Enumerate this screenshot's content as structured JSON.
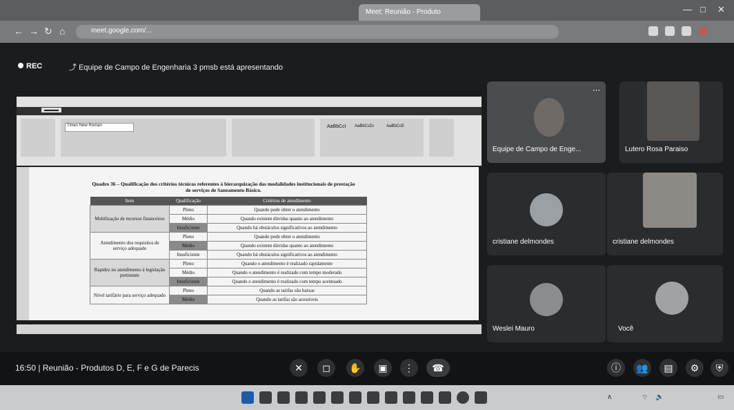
{
  "browser": {
    "tabs": [
      {
        "label": "Meet: Reunião - Produto"
      }
    ],
    "url": "meet.google.com/..."
  },
  "meet": {
    "rec_label": "REC",
    "presenting_banner": "Equipe de Campo de Engenharia 3 pmsb está apresentando",
    "participants": [
      {
        "name": "Equipe de Campo de Enge..."
      },
      {
        "name": "Lutero Rosa Paraiso"
      },
      {
        "name": "cristiane delmondes"
      },
      {
        "name": "cristiane delmondes"
      },
      {
        "name": "Weslei Mauro"
      },
      {
        "name": "Você"
      }
    ],
    "time": "16:50",
    "meeting_title": "Reunião - Produtos D, E, F e G de Parecis"
  },
  "document": {
    "font_box": "Times New Roman",
    "style_samples": [
      "AaBbCcI",
      "AaBbCcDı",
      "AaBbCcE"
    ],
    "caption": "Quadro 36 – Qualificação dos critérios técnicos referentes à bierarquização das modalidades institucionais de prestação de serviços de Saneamento Básico.",
    "table": {
      "headers": [
        "Item",
        "Qualificação",
        "Critérios de atendimento"
      ],
      "rows": [
        {
          "item": "Mobilização de recursos financeiros",
          "levels": [
            {
              "level": "Pleno",
              "criterion": "Quando pode obter o atendimento"
            },
            {
              "level": "Médio",
              "criterion": "Quando existem dúvidas quanto ao atendimento"
            },
            {
              "level": "Insuficiente",
              "criterion": "Quando há obstáculos significativos ao atendimento"
            }
          ]
        },
        {
          "item": "Atendimento dos requisitos de serviço adequado",
          "levels": [
            {
              "level": "Pleno",
              "criterion": "Quando pode obter o atendimento"
            },
            {
              "level": "Médio",
              "criterion": "Quando existem dúvidas quanto ao atendimento"
            },
            {
              "level": "Insuficiente",
              "criterion": "Quando há obstáculos significativos ao atendimento"
            }
          ]
        },
        {
          "item": "Rapidez no atendimento à legislação pertinente",
          "levels": [
            {
              "level": "Pleno",
              "criterion": "Quando o atendimento é realizado rapidamente"
            },
            {
              "level": "Médio",
              "criterion": "Quando o atendimento é realizado com tempo moderado"
            },
            {
              "level": "Insuficiente",
              "criterion": "Quando o atendimento é realizado com tempo acentuado"
            }
          ]
        },
        {
          "item": "Nível tarifário para serviço adequado",
          "levels": [
            {
              "level": "Pleno",
              "criterion": "Quando as tarifas são baixas"
            },
            {
              "level": "Médio",
              "criterion": "Quando as tarifas são acessíveis"
            }
          ]
        }
      ]
    }
  },
  "colors": {
    "meet_bg": "#1a1c1d",
    "tile_bg": "#2a2c2e",
    "doc_bg": "#f4f4f4"
  }
}
